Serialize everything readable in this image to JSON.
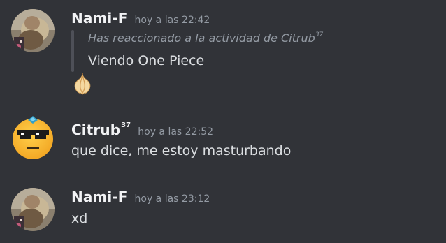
{
  "messages": [
    {
      "username": "Nami-F",
      "timestamp": "hoy a las 22:42",
      "reply_context": "Has reaccionado a la actividad de Citrub",
      "reply_context_sup": "37",
      "reply_text": "Viendo One Piece",
      "reaction_emoji": "onion-icon"
    },
    {
      "username": "Citrub",
      "username_sup": "37",
      "timestamp": "hoy a las 22:52",
      "content": "que dice, me estoy masturbando"
    },
    {
      "username": "Nami-F",
      "timestamp": "hoy a las 23:12",
      "content": "xd"
    }
  ],
  "colors": {
    "background": "#313338",
    "username": "#f2f3f5",
    "text": "#dbdee1",
    "muted": "#949ba4",
    "quote_bar": "#4e5058"
  }
}
